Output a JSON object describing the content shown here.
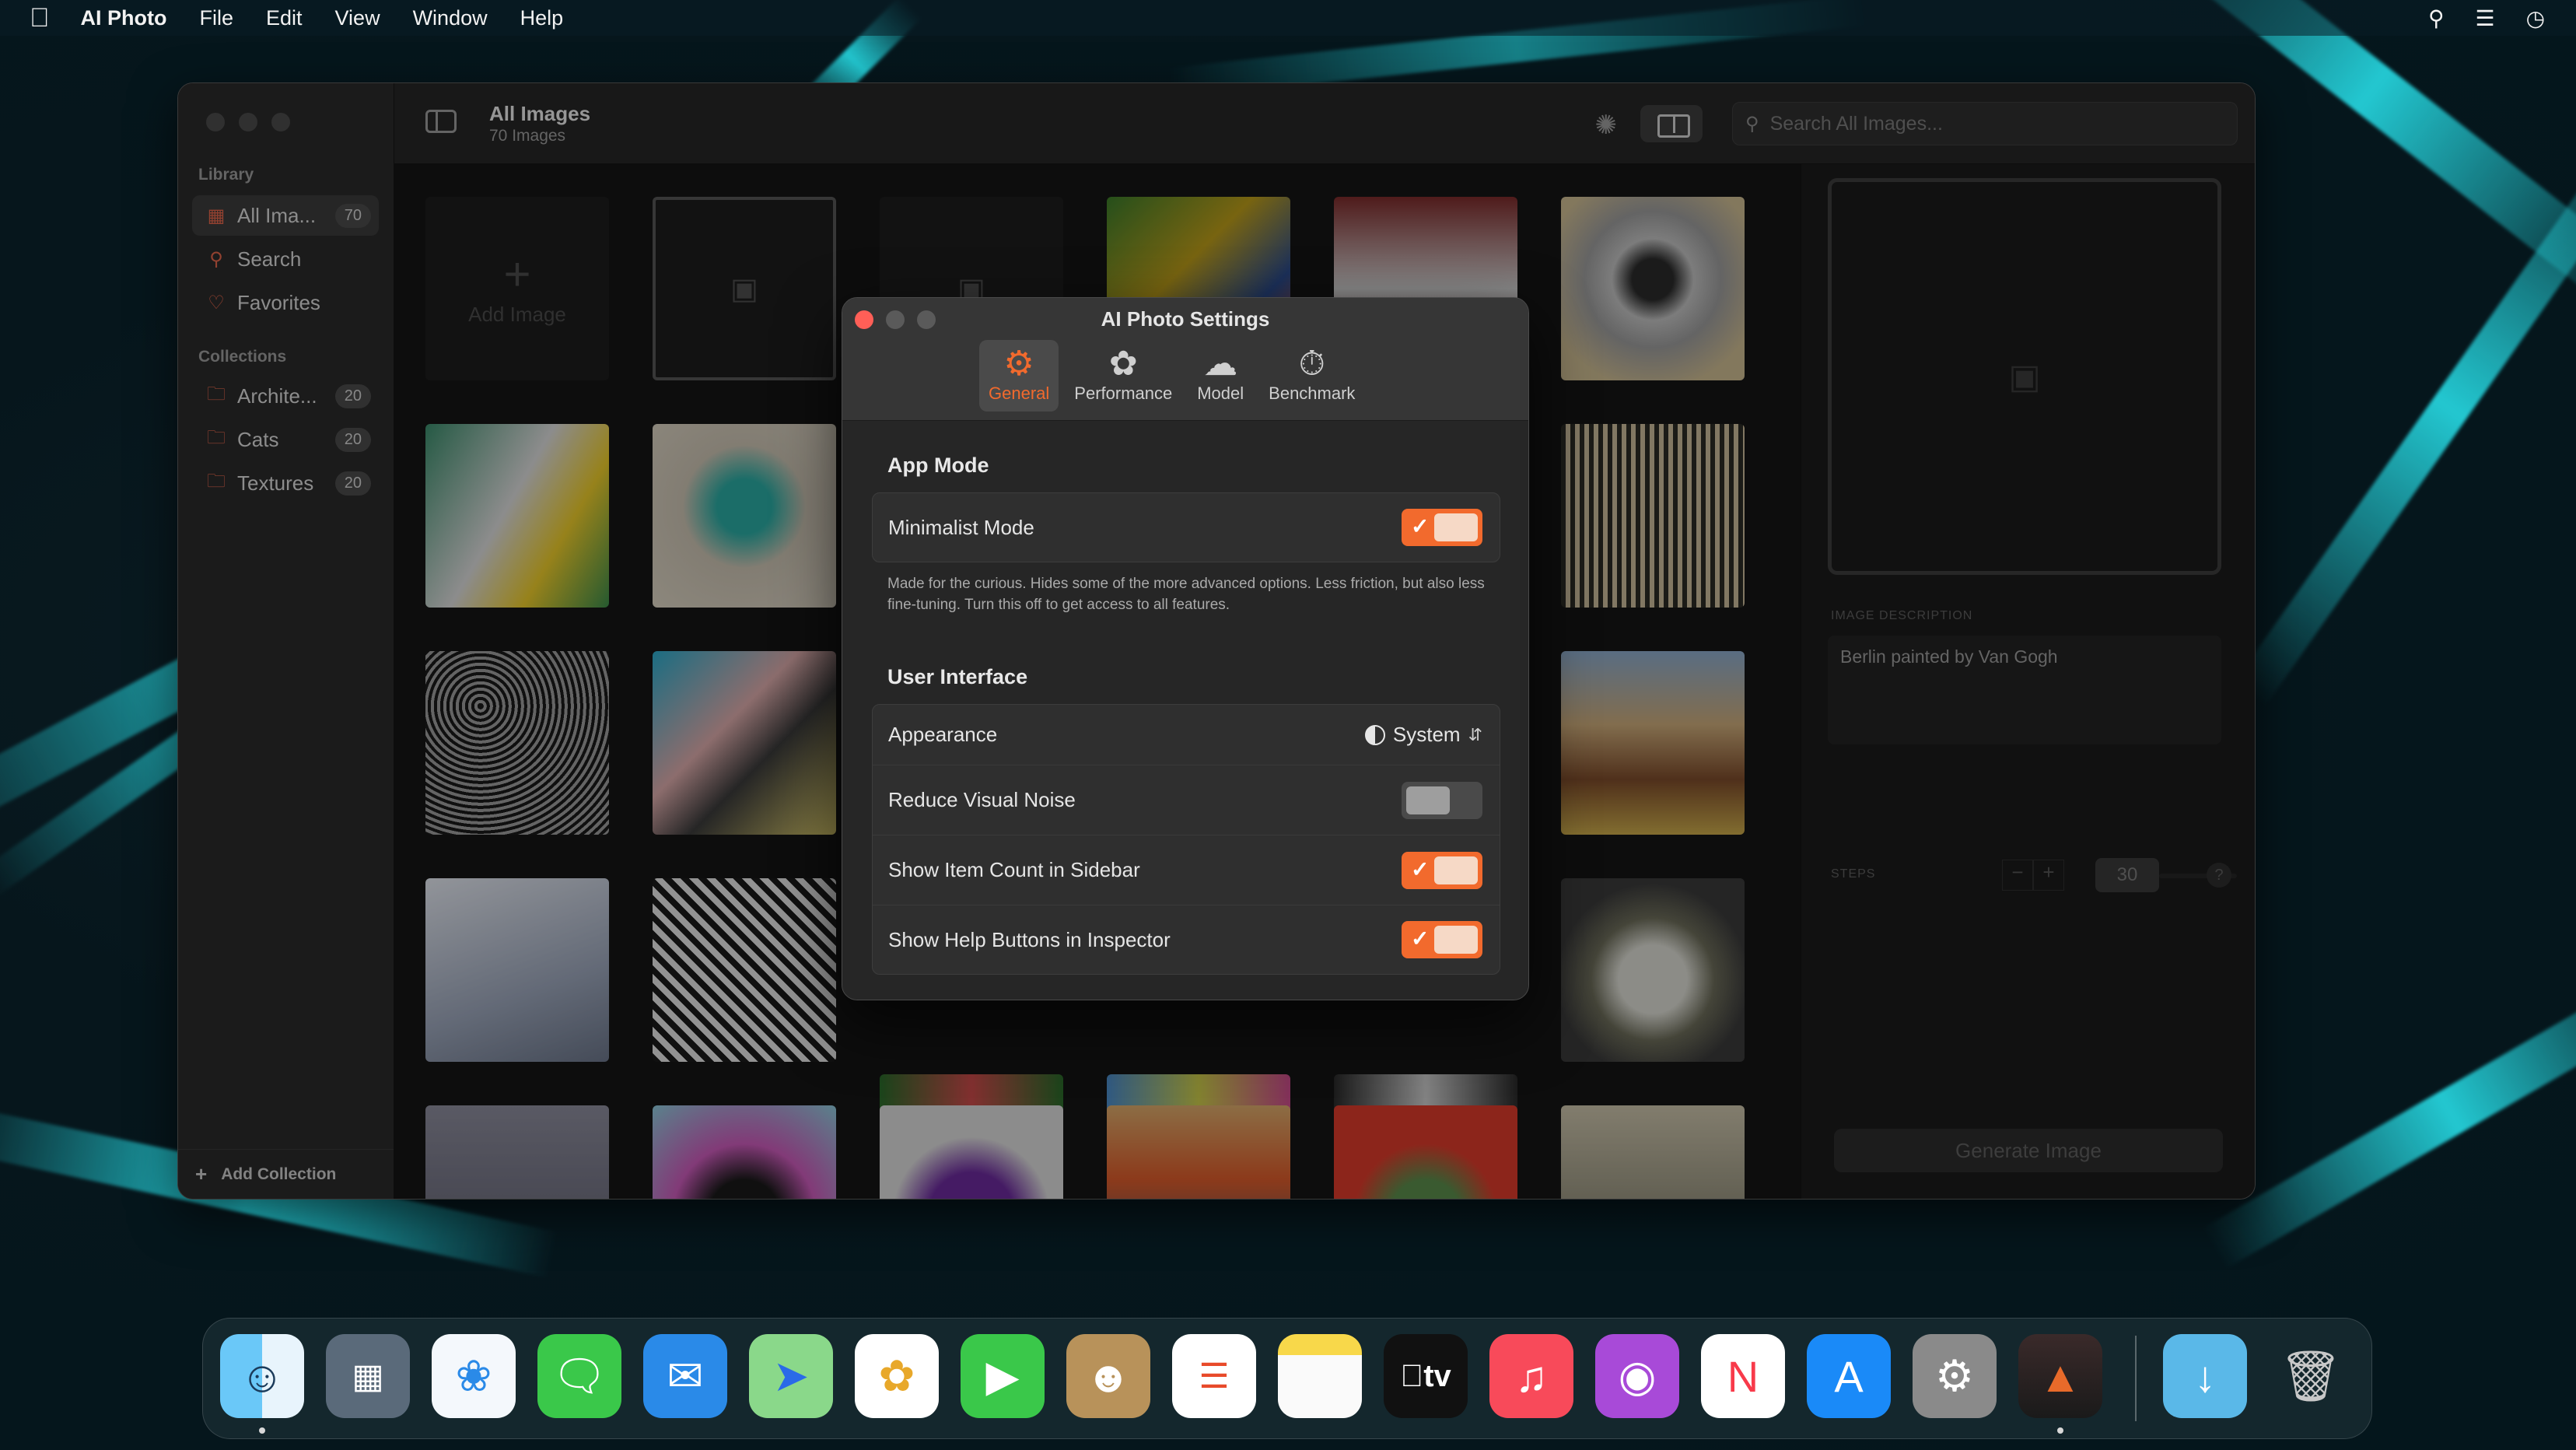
{
  "menubar": {
    "apple_icon": "apple-logo-icon",
    "app_name": "AI Photo",
    "items": [
      "File",
      "Edit",
      "View",
      "Window",
      "Help"
    ],
    "status_icons": [
      "search-icon",
      "control-center-icon",
      "clock-icon"
    ]
  },
  "sidebar": {
    "library_heading": "Library",
    "library_items": [
      {
        "label": "All Ima...",
        "count": "70",
        "icon": "grid-icon"
      },
      {
        "label": "Search",
        "icon": "search-icon"
      },
      {
        "label": "Favorites",
        "icon": "heart-icon"
      }
    ],
    "collections_heading": "Collections",
    "collections": [
      {
        "label": "Archite...",
        "count": "20",
        "icon": "folder-icon"
      },
      {
        "label": "Cats",
        "count": "20",
        "icon": "folder-icon"
      },
      {
        "label": "Textures",
        "count": "20",
        "icon": "folder-icon"
      }
    ],
    "add_collection": "Add Collection"
  },
  "toolbar": {
    "title": "All Images",
    "subtitle": "70 Images",
    "search_placeholder": "Search All Images..."
  },
  "grid": {
    "add_image_label": "Add Image"
  },
  "inspector": {
    "description_label": "IMAGE DESCRIPTION",
    "description_value": "Berlin painted by Van Gogh",
    "steps_label": "STEPS",
    "steps_value": "30",
    "help_label": "?",
    "generate_button": "Generate Image"
  },
  "settings": {
    "title": "AI Photo Settings",
    "tabs": [
      {
        "label": "General",
        "icon": "gear-icon",
        "active": true
      },
      {
        "label": "Performance",
        "icon": "rabbit-icon",
        "active": false
      },
      {
        "label": "Model",
        "icon": "brain-icon",
        "active": false
      },
      {
        "label": "Benchmark",
        "icon": "gauge-icon",
        "active": false
      }
    ],
    "app_mode_heading": "App Mode",
    "minimalist_label": "Minimalist Mode",
    "minimalist_on": true,
    "minimalist_note": "Made for the curious. Hides some of the more advanced options. Less friction, but also less fine-tuning. Turn this off to get access to all features.",
    "ui_heading": "User Interface",
    "appearance_label": "Appearance",
    "appearance_value": "System",
    "reduce_noise_label": "Reduce Visual Noise",
    "reduce_noise_on": false,
    "item_count_label": "Show Item Count in Sidebar",
    "item_count_on": true,
    "help_buttons_label": "Show Help Buttons in Inspector",
    "help_buttons_on": true
  },
  "dock": {
    "apps": [
      "finder-icon",
      "launchpad-icon",
      "safari-icon",
      "messages-icon",
      "mail-icon",
      "maps-icon",
      "photos-icon",
      "facetime-icon",
      "contacts-icon",
      "reminders-icon",
      "notes-icon",
      "tv-icon",
      "music-icon",
      "podcasts-icon",
      "news-icon",
      "app-store-icon",
      "system-settings-icon",
      "ai-photo-app-icon"
    ],
    "tv_label": "tv",
    "downloads": "downloads-folder-icon",
    "trash": "trash-icon"
  },
  "colors": {
    "accent": "#f26a2d",
    "wallpaper_cyan": "#1fd8e0"
  }
}
